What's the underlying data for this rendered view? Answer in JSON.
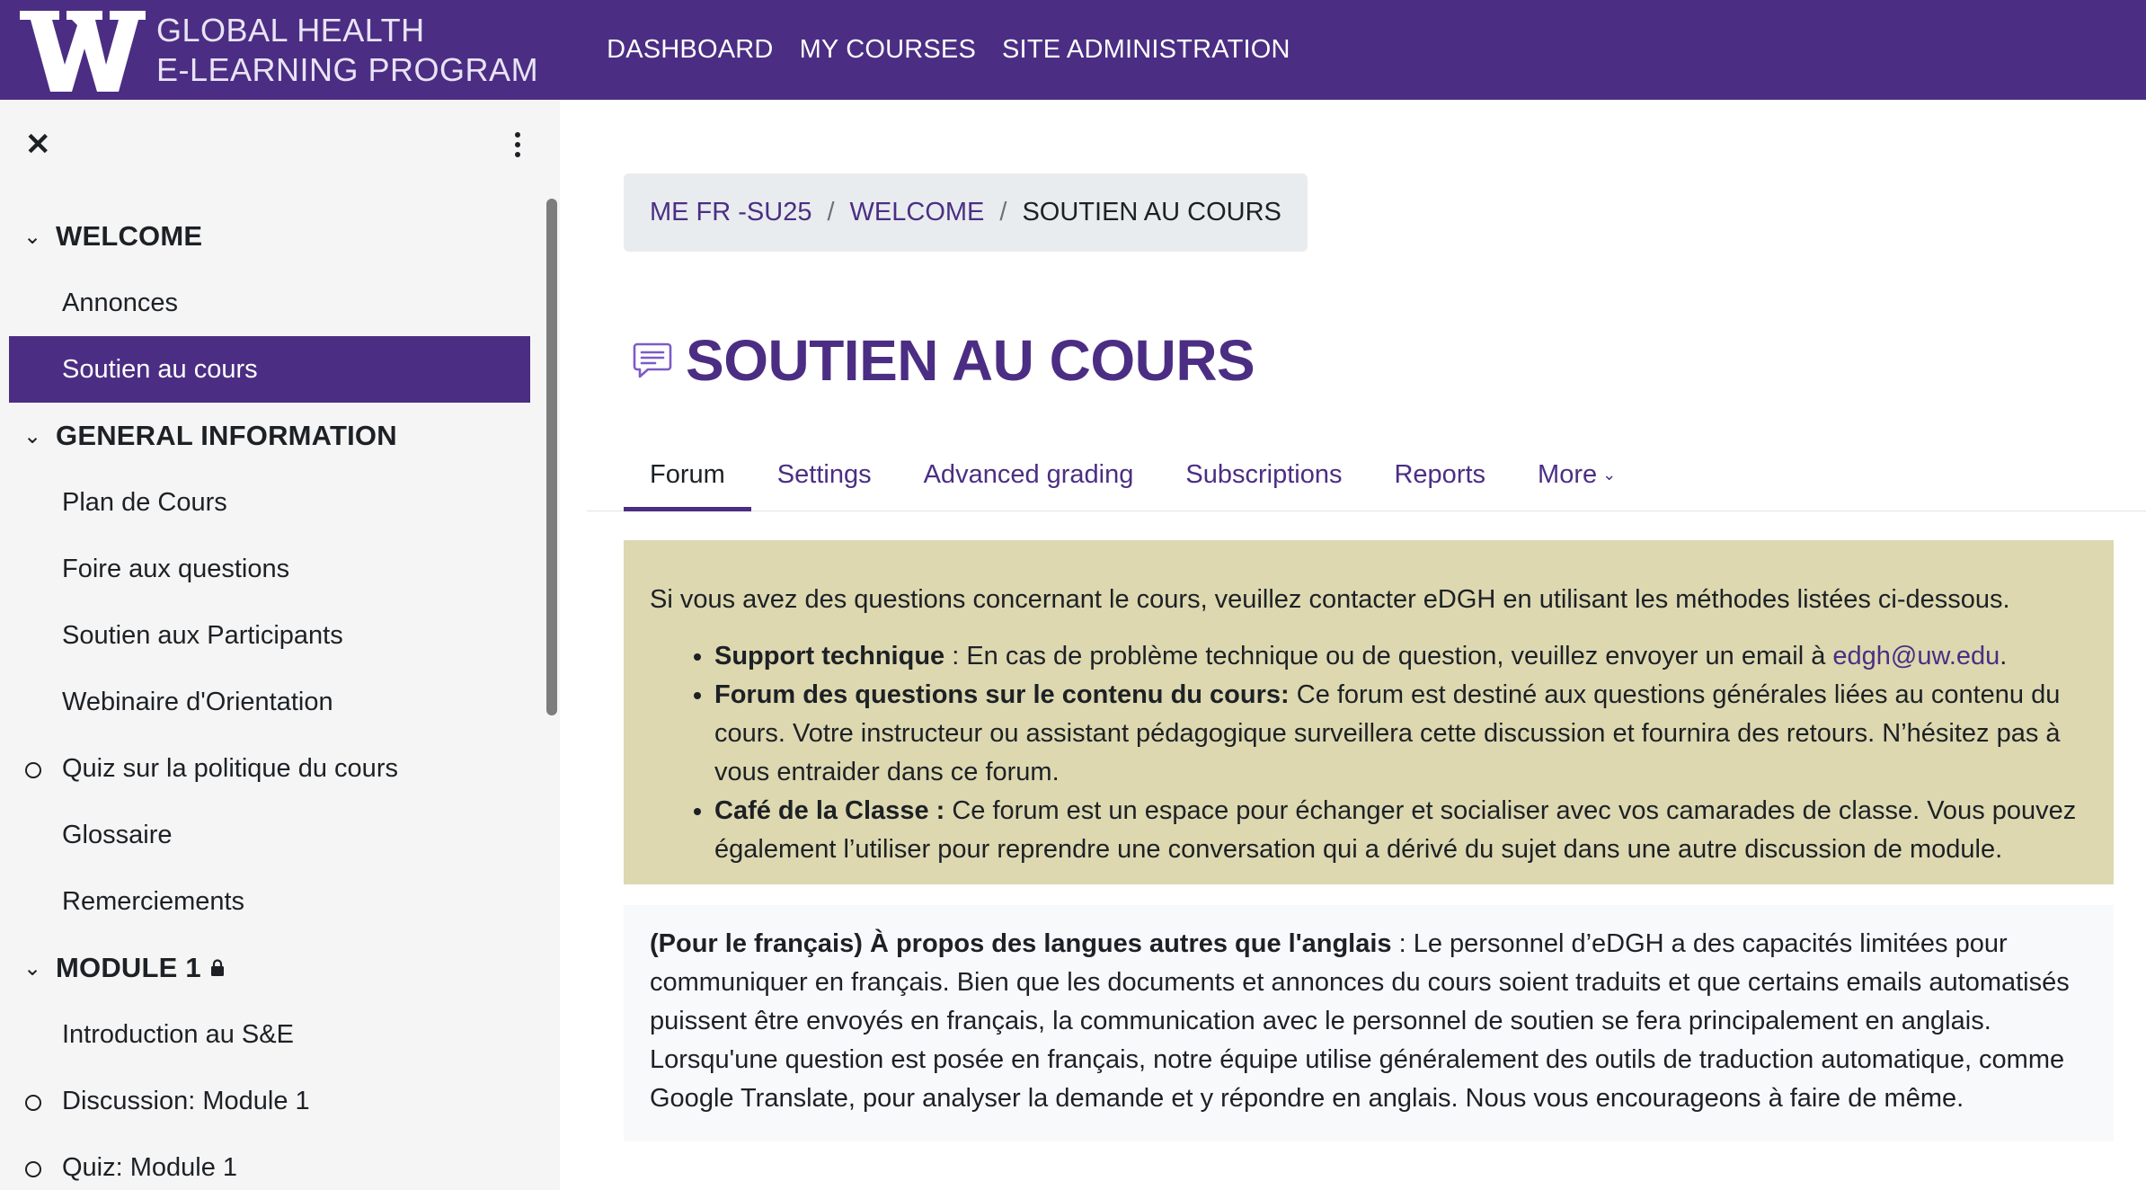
{
  "brand": {
    "line1": "GLOBAL HEALTH",
    "line2": "E-LEARNING PROGRAM",
    "colors": {
      "primary": "#4b2e83",
      "intro_bg": "#ddd8b0",
      "breadcrumb_bg": "#e9ecef"
    }
  },
  "navbar": {
    "links": [
      {
        "label": "DASHBOARD"
      },
      {
        "label": "MY COURSES"
      },
      {
        "label": "SITE ADMINISTRATION"
      }
    ]
  },
  "drawer": {
    "close_icon": "close-icon",
    "menu_icon": "kebab-menu-icon",
    "sections": [
      {
        "title": "WELCOME",
        "items": [
          {
            "label": "Annonces"
          },
          {
            "label": "Soutien au cours"
          }
        ]
      },
      {
        "title": "GENERAL INFORMATION",
        "items": [
          {
            "label": "Plan de Cours"
          },
          {
            "label": "Foire aux questions"
          },
          {
            "label": "Soutien aux Participants"
          },
          {
            "label": "Webinaire d'Orientation"
          },
          {
            "label": "Quiz sur la politique du cours"
          },
          {
            "label": "Glossaire"
          },
          {
            "label": "Remerciements"
          }
        ]
      },
      {
        "title": "MODULE 1",
        "items": [
          {
            "label": "Introduction au S&E"
          },
          {
            "label": "Discussion: Module 1"
          },
          {
            "label": "Quiz: Module 1"
          }
        ]
      }
    ]
  },
  "breadcrumb": {
    "items": [
      {
        "label": "ME FR -SU25"
      },
      {
        "label": "WELCOME"
      },
      {
        "label": "SOUTIEN AU COURS"
      }
    ],
    "separator": "/"
  },
  "page": {
    "title": "SOUTIEN AU COURS"
  },
  "tabs": [
    {
      "label": "Forum"
    },
    {
      "label": "Settings"
    },
    {
      "label": "Advanced grading"
    },
    {
      "label": "Subscriptions"
    },
    {
      "label": "Reports"
    },
    {
      "label": "More"
    }
  ],
  "intro": {
    "lead": "Si vous avez des questions concernant le cours, veuillez contacter eDGH en utilisant les méthodes listées ci-dessous.",
    "bullets": [
      {
        "bold": "Support technique",
        "text": " : En cas de problème technique ou de question, veuillez envoyer un email à ",
        "link": "edgh@uw.edu",
        "after": "."
      },
      {
        "bold": "Forum des questions sur le contenu du cours:",
        "text": " Ce forum est destiné aux questions générales liées au contenu du cours. Votre instructeur ou assistant pédagogique surveillera cette discussion et fournira des retours. N’hésitez pas à vous entraider dans ce forum."
      },
      {
        "bold": "Café de la Classe :",
        "text": " Ce forum est un espace pour échanger et socialiser avec vos camarades de classe. Vous pouvez également l’utiliser pour reprendre une conversation qui a dérivé du sujet dans une autre discussion de module."
      }
    ]
  },
  "language_note": {
    "bold": "(Pour le français) À propos des langues autres que l'anglais",
    "text": " : Le personnel d’eDGH a des capacités limitées pour communiquer en français. Bien que les documents et annonces du cours soient traduits et que certains emails automatisés puissent être envoyés en français, la communication avec le personnel de soutien se fera principalement en anglais. Lorsqu'une question est posée en français, notre équipe utilise généralement des outils de traduction automatique, comme Google Translate, pour analyser la demande et y répondre en anglais. Nous vous encourageons à faire de même."
  }
}
